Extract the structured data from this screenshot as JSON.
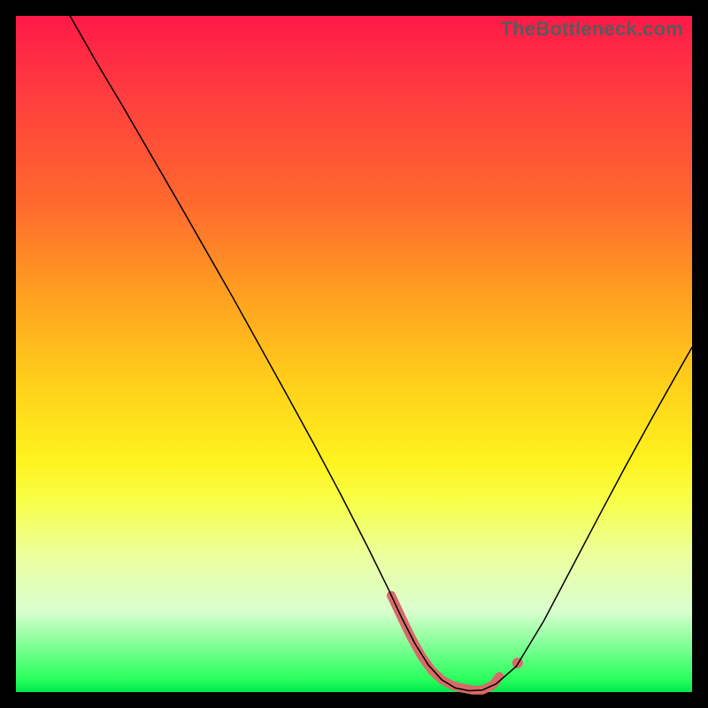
{
  "watermark": "TheBottleneck.com",
  "chart_data": {
    "type": "line",
    "title": "",
    "xlabel": "",
    "ylabel": "",
    "xlim": [
      0,
      100
    ],
    "ylim": [
      0,
      100
    ],
    "series": [
      {
        "name": "bottleneck-curve",
        "color": "#000000",
        "stroke_width": 1.5,
        "x": [
          8,
          12,
          16,
          20,
          24,
          28,
          32,
          36,
          40,
          44,
          48,
          52,
          55,
          57,
          59,
          61,
          63,
          65,
          67,
          69,
          71,
          74,
          78,
          82,
          86,
          90,
          94,
          98,
          100
        ],
        "y": [
          100,
          93,
          86.3,
          79.4,
          72.5,
          65.5,
          58.5,
          51.3,
          44.1,
          36.8,
          29.3,
          21.5,
          15.4,
          11.1,
          7.2,
          4.0,
          1.8,
          0.6,
          0.2,
          0.3,
          1.2,
          3.8,
          10.4,
          18.0,
          25.6,
          33.1,
          40.4,
          47.5,
          51.0
        ]
      },
      {
        "name": "highlight-segment",
        "color": "#d96a6a",
        "stroke_width": 10,
        "x": [
          55.5,
          57,
          58.5,
          60,
          61.5,
          63,
          64.5,
          66,
          67.5,
          69,
          70.5,
          71.5
        ],
        "y": [
          14.3,
          11.1,
          8.0,
          5.3,
          3.2,
          1.8,
          1.0,
          0.6,
          0.3,
          0.3,
          1.0,
          2.3
        ]
      },
      {
        "name": "highlight-dot-upper",
        "color": "#d96a6a",
        "type_hint": "point",
        "x": [
          74.2
        ],
        "y": [
          4.3
        ]
      }
    ],
    "annotations": []
  }
}
